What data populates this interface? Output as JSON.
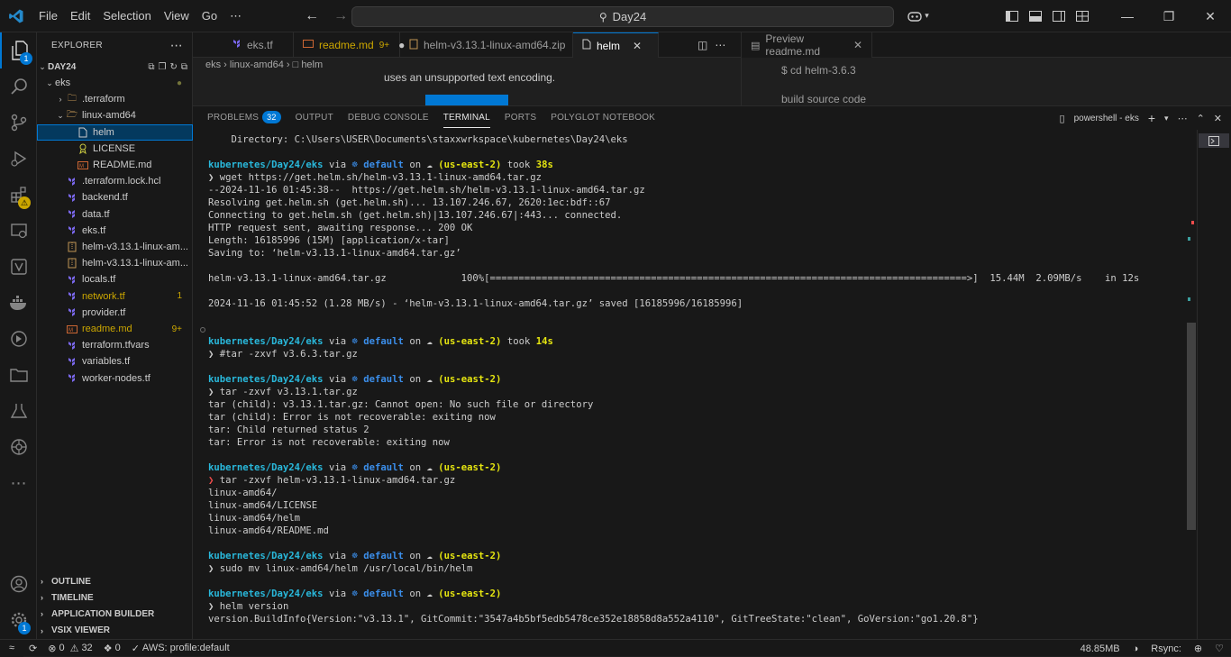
{
  "menu": [
    "File",
    "Edit",
    "Selection",
    "View",
    "Go",
    "⋯"
  ],
  "search": {
    "text": "Day24"
  },
  "activity_bar": {
    "explorer_badge": "1",
    "items": [
      "explorer-icon",
      "search-icon",
      "source-control-icon",
      "run-debug-icon",
      "extensions-icon",
      "remote-explorer-icon",
      "aws-icon",
      "docker-icon",
      "terraform-icon",
      "folder-icon",
      "lab-icon",
      "kubernetes-icon",
      "more-icon"
    ],
    "accounts_icon": "account-icon",
    "manage_badge": "1"
  },
  "sidebar": {
    "title": "EXPLORER",
    "root": "DAY24",
    "sections": [
      "OUTLINE",
      "TIMELINE",
      "APPLICATION BUILDER",
      "VSIX VIEWER"
    ],
    "tree": [
      {
        "label": "eks",
        "depth": 1,
        "type": "folder-open",
        "color": "#cccccc",
        "deco": "●",
        "deco_color": "#73743a"
      },
      {
        "label": ".terraform",
        "depth": 2,
        "type": "folder",
        "color": "#cccccc"
      },
      {
        "label": "linux-amd64",
        "depth": 2,
        "type": "folder-open",
        "color": "#cccccc"
      },
      {
        "label": "helm",
        "depth": 3,
        "type": "file",
        "color": "#cccccc",
        "selected": true
      },
      {
        "label": "LICENSE",
        "depth": 3,
        "type": "license",
        "color": "#cccccc"
      },
      {
        "label": "README.md",
        "depth": 3,
        "type": "md",
        "color": "#cccccc"
      },
      {
        "label": ".terraform.lock.hcl",
        "depth": 2,
        "type": "tf",
        "color": "#cccccc"
      },
      {
        "label": "backend.tf",
        "depth": 2,
        "type": "tf",
        "color": "#cccccc"
      },
      {
        "label": "data.tf",
        "depth": 2,
        "type": "tf",
        "color": "#cccccc"
      },
      {
        "label": "eks.tf",
        "depth": 2,
        "type": "tf",
        "color": "#cccccc"
      },
      {
        "label": "helm-v3.13.1-linux-am...",
        "depth": 2,
        "type": "zip",
        "color": "#cccccc"
      },
      {
        "label": "helm-v3.13.1-linux-am...",
        "depth": 2,
        "type": "zip",
        "color": "#cccccc"
      },
      {
        "label": "locals.tf",
        "depth": 2,
        "type": "tf",
        "color": "#cccccc"
      },
      {
        "label": "network.tf",
        "depth": 2,
        "type": "tf",
        "color": "#cca700",
        "deco": "1",
        "deco_color": "#cca700"
      },
      {
        "label": "provider.tf",
        "depth": 2,
        "type": "tf",
        "color": "#cccccc"
      },
      {
        "label": "readme.md",
        "depth": 2,
        "type": "md",
        "color": "#cca700",
        "deco": "9+",
        "deco_color": "#cca700"
      },
      {
        "label": "terraform.tfvars",
        "depth": 2,
        "type": "tf",
        "color": "#cccccc"
      },
      {
        "label": "variables.tf",
        "depth": 2,
        "type": "tf",
        "color": "#cccccc"
      },
      {
        "label": "worker-nodes.tf",
        "depth": 2,
        "type": "tf",
        "color": "#cccccc"
      }
    ]
  },
  "tabs": [
    {
      "label": "eks.tf",
      "icon": "terraform-icon",
      "active": false
    },
    {
      "label": "readme.md",
      "icon": "markdown-icon",
      "mod": "9+",
      "dot": "●",
      "active": false
    },
    {
      "label": "helm-v3.13.1-linux-amd64.zip",
      "icon": "zip-icon",
      "active": false
    },
    {
      "label": "helm",
      "icon": "file-icon",
      "active": true
    }
  ],
  "breadcrumb": [
    "eks",
    "linux-amd64",
    "helm"
  ],
  "editor": {
    "message": "uses an unsupported text encoding."
  },
  "preview": {
    "tab_label": "Preview readme.md",
    "lines": [
      "$ cd helm-3.6.3",
      "build source code"
    ]
  },
  "panel": {
    "tabs": [
      {
        "label": "PROBLEMS",
        "badge": "32"
      },
      {
        "label": "OUTPUT"
      },
      {
        "label": "DEBUG CONSOLE"
      },
      {
        "label": "TERMINAL",
        "active": true
      },
      {
        "label": "PORTS"
      },
      {
        "label": "POLYGLOT NOTEBOOK"
      }
    ],
    "terminal_name": "powershell - eks"
  },
  "terminal": [
    {
      "type": "text",
      "text": "    Directory: C:\\Users\\USER\\Documents\\staxxwrkspace\\kubernetes\\Day24\\eks"
    },
    {
      "type": "blank"
    },
    {
      "type": "prompt",
      "path": "kubernetes/Day24/eks",
      "ctx": "default",
      "region": "(us-east-2)",
      "took": "38s"
    },
    {
      "type": "cmd",
      "arrow": "❯",
      "arrow_color": "#cccccc",
      "text": "wget https://get.helm.sh/helm-v3.13.1-linux-amd64.tar.gz"
    },
    {
      "type": "text",
      "text": "--2024-11-16 01:45:38--  https://get.helm.sh/helm-v3.13.1-linux-amd64.tar.gz"
    },
    {
      "type": "text",
      "text": "Resolving get.helm.sh (get.helm.sh)... 13.107.246.67, 2620:1ec:bdf::67"
    },
    {
      "type": "text",
      "text": "Connecting to get.helm.sh (get.helm.sh)|13.107.246.67|:443... connected."
    },
    {
      "type": "text",
      "text": "HTTP request sent, awaiting response... 200 OK"
    },
    {
      "type": "text",
      "text": "Length: 16185996 (15M) [application/x-tar]"
    },
    {
      "type": "text",
      "text": "Saving to: ‘helm-v3.13.1-linux-amd64.tar.gz’"
    },
    {
      "type": "blank"
    },
    {
      "type": "text",
      "text": "helm-v3.13.1-linux-amd64.tar.gz             100%[===================================================================================>]  15.44M  2.09MB/s    in 12s"
    },
    {
      "type": "blank"
    },
    {
      "type": "text",
      "text": "2024-11-16 01:45:52 (1.28 MB/s) - ‘helm-v3.13.1-linux-amd64.tar.gz’ saved [16185996/16185996]"
    },
    {
      "type": "blank"
    },
    {
      "type": "blank"
    },
    {
      "type": "prompt",
      "path": "kubernetes/Day24/eks",
      "ctx": "default",
      "region": "(us-east-2)",
      "took": "14s"
    },
    {
      "type": "cmd",
      "arrow": "❯",
      "arrow_color": "#cccccc",
      "text": "#tar -zxvf v3.6.3.tar.gz"
    },
    {
      "type": "blank"
    },
    {
      "type": "prompt",
      "path": "kubernetes/Day24/eks",
      "ctx": "default",
      "region": "(us-east-2)"
    },
    {
      "type": "cmd",
      "arrow": "❯",
      "arrow_color": "#cccccc",
      "text": "tar -zxvf v3.13.1.tar.gz"
    },
    {
      "type": "text",
      "text": "tar (child): v3.13.1.tar.gz: Cannot open: No such file or directory"
    },
    {
      "type": "text",
      "text": "tar (child): Error is not recoverable: exiting now"
    },
    {
      "type": "text",
      "text": "tar: Child returned status 2"
    },
    {
      "type": "text",
      "text": "tar: Error is not recoverable: exiting now"
    },
    {
      "type": "blank"
    },
    {
      "type": "prompt",
      "path": "kubernetes/Day24/eks",
      "ctx": "default",
      "region": "(us-east-2)"
    },
    {
      "type": "cmd",
      "arrow": "❯",
      "arrow_color": "#f14c4c",
      "text": "tar -zxvf helm-v3.13.1-linux-amd64.tar.gz"
    },
    {
      "type": "text",
      "text": "linux-amd64/"
    },
    {
      "type": "text",
      "text": "linux-amd64/LICENSE"
    },
    {
      "type": "text",
      "text": "linux-amd64/helm"
    },
    {
      "type": "text",
      "text": "linux-amd64/README.md"
    },
    {
      "type": "blank"
    },
    {
      "type": "prompt",
      "path": "kubernetes/Day24/eks",
      "ctx": "default",
      "region": "(us-east-2)"
    },
    {
      "type": "cmd",
      "arrow": "❯",
      "arrow_color": "#cccccc",
      "text": "sudo mv linux-amd64/helm /usr/local/bin/helm"
    },
    {
      "type": "blank"
    },
    {
      "type": "prompt",
      "path": "kubernetes/Day24/eks",
      "ctx": "default",
      "region": "(us-east-2)"
    },
    {
      "type": "cmd",
      "arrow": "❯",
      "arrow_color": "#cccccc",
      "text": "helm version"
    },
    {
      "type": "text",
      "text": "version.BuildInfo{Version:\"v3.13.1\", GitCommit:\"3547a4b5bf5edb5478ce352e18858d8a552a4110\", GitTreeState:\"clean\", GoVersion:\"go1.20.8\"}"
    }
  ],
  "prompt_words": {
    "via": "via",
    "on": "on",
    "took": "took",
    "cloud": "☁",
    "k8s": "☸"
  },
  "statusbar": {
    "errors": "0",
    "warnings": "32",
    "ports": "0",
    "aws": "AWS: profile:default",
    "memory": "48.85MB",
    "rsync": "Rsync:"
  }
}
